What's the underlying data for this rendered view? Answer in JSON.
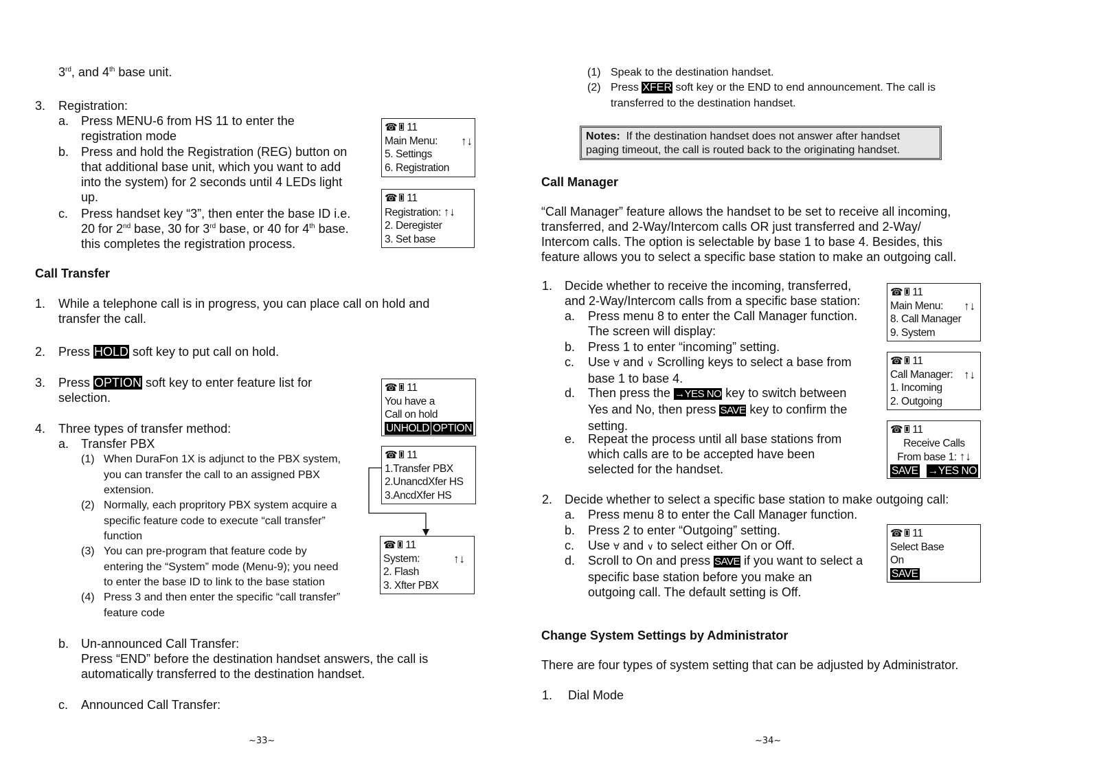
{
  "left_page": {
    "cont_line": {
      "pre": "3",
      "sup1": "rd",
      "mid": ", and 4",
      "sup2": "th",
      "post": " base unit."
    },
    "registration": {
      "num": "3.",
      "title": "Registration:",
      "a": {
        "label": "a.",
        "lines": [
          "Press MENU-6 from HS 11 to enter the",
          "registration mode"
        ]
      },
      "b": {
        "label": "b.",
        "lines": [
          "Press and hold the Registration (REG) button on",
          "that additional base unit, which you want to add",
          "into the system) for 2 seconds until 4 LEDs light",
          "up."
        ]
      },
      "c": {
        "label": "c.",
        "line1": "Press handset key “3”, then enter the base ID i.e.",
        "line2": {
          "p1": "20 for 2",
          "s1": "nd",
          "p2": " base, 30 for 3",
          "s2": "rd",
          "p3": " base, or 40 for 4",
          "s3": "th",
          "p4": " base."
        },
        "line3": "this completes the registration process."
      }
    },
    "call_transfer": {
      "heading": "Call Transfer",
      "items": {
        "i1": {
          "num": "1.",
          "lines": [
            " While a telephone call is in progress, you can place call on hold and",
            "transfer the call."
          ]
        },
        "i2": {
          "num": "2.",
          "pre": "Press ",
          "key": "HOLD",
          "post": " soft key to put call on hold."
        },
        "i3": {
          "num": "3.",
          "pre": "Press ",
          "key": "OPTION",
          "post": " soft key to enter feature list for",
          "line2": "selection."
        },
        "i4": {
          "num": "4.",
          "text": "Three types of transfer method:"
        }
      },
      "a": {
        "label": "a.",
        "title": "Transfer PBX",
        "subs": [
          {
            "num": "(1)",
            "lines": [
              "When DuraFon 1X is adjunct to the PBX system,",
              "you can transfer the call to an assigned PBX",
              "extension."
            ]
          },
          {
            "num": "(2)",
            "lines": [
              "Normally, each propritory PBX system acquire a",
              "specific feature code to execute “call transfer”",
              "function"
            ]
          },
          {
            "num": "(3)",
            "lines": [
              "You can pre-program that feature code by",
              "entering the “System” mode (Menu-9); you need",
              "to enter the base ID to link to the base station"
            ]
          },
          {
            "num": "(4)",
            "lines": [
              "Press 3 and then enter the specific “call transfer”",
              "feature code"
            ]
          }
        ]
      },
      "b": {
        "label": "b.",
        "title": "Un-announced Call Transfer:",
        "lines": [
          "Press “END” before the destination handset answers, the call is",
          "automatically transferred to the destination handset."
        ]
      },
      "c": {
        "label": "c.",
        "title": "Announced Call Transfer:"
      }
    },
    "screens": {
      "main_menu": {
        "hs": "11",
        "title": "Main Menu:",
        "arrows": "↑↓",
        "l1": "5. Settings",
        "l2": "6. Registration"
      },
      "registration": {
        "hs": "11",
        "title": "Registration:",
        "arrows": "↑↓",
        "l1": "2. Deregister",
        "l2": "3. Set base"
      },
      "hold": {
        "hs": "11",
        "l1": "You have a",
        "l2": "Call on hold",
        "sk1": "UNHOLD",
        "sk2": "OPTION"
      },
      "options": {
        "hs": "11",
        "l1": "1.Transfer PBX",
        "l2": "2.UnancdXfer HS",
        "l3": "3.AncdXfer HS"
      },
      "system": {
        "hs": "11",
        "title": "System:",
        "arrows": "↑↓",
        "l1": "2. Flash",
        "l2": "3. Xfter PBX"
      }
    },
    "page_number": "~33~"
  },
  "right_page": {
    "announced_steps": [
      {
        "num": "(1)",
        "text": "Speak to the destination handset."
      },
      {
        "num": "(2)",
        "pre": "Press ",
        "key": "XFER",
        "post": " soft key or the END to end announcement. The call is",
        "line2": "transferred to the destination handset."
      }
    ],
    "note": {
      "label": "Notes:",
      "text": "  If the destination handset does not answer after handset",
      "line2": "paging timeout, the call is routed back to the originating handset."
    },
    "call_manager": {
      "heading": "Call Manager",
      "intro": [
        "“Call Manager” feature allows the handset to be set to receive all incoming,",
        "transferred, and 2-Way/Intercom calls OR just transferred and 2-Way/",
        "Intercom calls. The option is selectable by base 1 to base 4.  Besides, this",
        "feature allows you to select a specific base station to make an outgoing call."
      ],
      "step1": {
        "num": "1.",
        "lines": [
          "Decide whether to receive the incoming, transferred,",
          "and 2-Way/Intercom calls from a specific base station:"
        ],
        "a": {
          "label": "a.",
          "lines": [
            "Press menu 8 to enter the Call Manager function.",
            "The screen will display:"
          ]
        },
        "b": {
          "label": "b.",
          "text": "Press 1 to enter “incoming” setting."
        },
        "c": {
          "label": "c.",
          "pre": "Use ",
          "up": "Ɐ",
          "mid": " and ",
          "down": "∨",
          "post": " Scrolling keys to select a base from",
          "line2": "base 1 to base 4."
        },
        "d": {
          "label": "d.",
          "pre": "Then press the ",
          "key": "→YES NO",
          "post": " key to switch between",
          "l2pre": "Yes and No, then press ",
          "key2": "SAVE",
          "l2post": " key to confirm the",
          "line3": "setting."
        },
        "e": {
          "label": "e.",
          "lines": [
            "Repeat the process until all base stations from",
            "which calls are to be accepted have been",
            "selected for the handset."
          ]
        }
      },
      "step2": {
        "num": "2.",
        "text": "Decide whether to select a specific base station to make outgoing call:",
        "a": {
          "label": "a.",
          "text": "Press menu 8 to enter the Call Manager function."
        },
        "b": {
          "label": "b.",
          "text": "Press 2 to enter “Outgoing” setting."
        },
        "c": {
          "label": "c.",
          "pre": "Use ",
          "up": "Ɐ",
          "mid": " and ",
          "down": "∨",
          "post": " to select either On or Off."
        },
        "d": {
          "label": "d.",
          "pre": "Scroll to On and press ",
          "key": "SAVE",
          "post": " if you want to select a",
          "lines": [
            "specific base station before you make an",
            "outgoing call.  The default setting is Off."
          ]
        }
      }
    },
    "screens": {
      "main_menu": {
        "hs": "11",
        "title": "Main Menu:",
        "arrows": "↑↓",
        "l1": "8. Call Manager",
        "l2": "9. System"
      },
      "call_manager": {
        "hs": "11",
        "title": "Call Manager:",
        "arrows": "↑↓",
        "l1": "1. Incoming",
        "l2": "2. Outgoing"
      },
      "receive": {
        "hs": "11",
        "l1": "Receive Calls",
        "l2": "From base 1:",
        "arrows": "↑↓",
        "sk1": "SAVE",
        "sk2": "→YES NO"
      },
      "select_base": {
        "hs": "11",
        "l1": "Select Base",
        "l2": "On",
        "sk1": "SAVE"
      }
    },
    "admin": {
      "heading": "Change System Settings by Administrator",
      "text": "There are four types of system setting that can be adjusted by Administrator.",
      "item1": {
        "num": "1.",
        "text": "Dial Mode"
      }
    },
    "page_number": "~34~"
  }
}
